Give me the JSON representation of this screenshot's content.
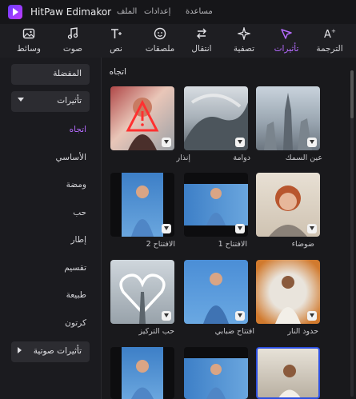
{
  "app": {
    "title": "HitPaw Edimakor"
  },
  "menu": [
    "الملف",
    "إعدادات",
    "مساعدة"
  ],
  "toolbar": {
    "items": [
      {
        "label": "الترجمة",
        "icon": "translate-icon"
      },
      {
        "label": "تأثيرات",
        "icon": "effects-icon",
        "active": true
      },
      {
        "label": "تصفية",
        "icon": "filter-icon"
      },
      {
        "label": "انتقال",
        "icon": "transition-icon"
      },
      {
        "label": "ملصقات",
        "icon": "sticker-icon"
      },
      {
        "label": "نص",
        "icon": "text-icon"
      },
      {
        "label": "صوت",
        "icon": "music-icon"
      },
      {
        "label": "وسائط",
        "icon": "media-icon"
      }
    ],
    "accent": "#b56bff"
  },
  "sidebar": {
    "favorites": "المفضلة",
    "effects_group": "تأثيرات",
    "items": [
      "اتجاه",
      "الأساسي",
      "ومضة",
      "حب",
      "إطار",
      "تقسيم",
      "طبيعة",
      "كرتون"
    ],
    "audio_group": "تأثيرات صوتية"
  },
  "main": {
    "section_title": "اتجاه",
    "thumbs": [
      {
        "caption": "عين السمك"
      },
      {
        "caption": "دوامة"
      },
      {
        "caption": "إنذار"
      },
      {
        "caption": "ضوضاء"
      },
      {
        "caption": "الافتتاح 1"
      },
      {
        "caption": "الافتتاح 2"
      },
      {
        "caption": "حدود النار"
      },
      {
        "caption": "افتتاح ضبابي"
      },
      {
        "caption": "حب التركيز"
      }
    ]
  }
}
